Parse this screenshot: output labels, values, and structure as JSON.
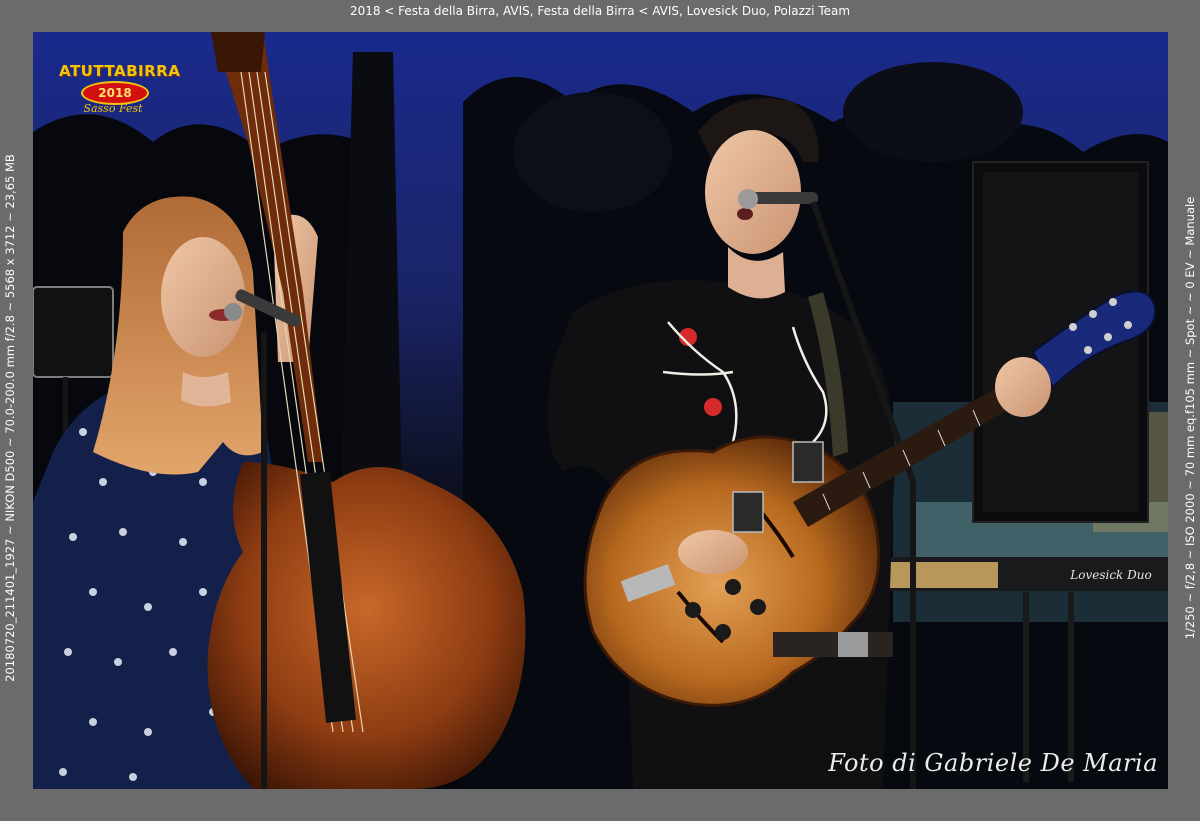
{
  "header": {
    "caption": "2018 < Festa della Birra, AVIS, Festa della Birra < AVIS, Lovesick Duo, Polazzi Team"
  },
  "sidebar_left": {
    "caption": "20180720_211401_1927 ~ NIKON D500 ~ 70.0-200.0 mm f/2.8 ~ 5568 x 3712 ~ 23,65 MB"
  },
  "sidebar_right": {
    "caption": "1/250 ~ f/2,8 ~ ISO 2000 ~ 70 mm eq.f105 mm ~ Spot ~ ~ 0 EV ~ Manuale"
  },
  "photo": {
    "logo": {
      "line1": "ATUTTABIRRA",
      "year": "2018",
      "line2": "Sasso Fest"
    },
    "watermark": "Foto di Gabriele De Maria",
    "keyboard_brand": "Lovesick Duo"
  },
  "colors": {
    "frame": "#6b6b6b",
    "sky": "#1c2f8a",
    "guitar": "#b8691f",
    "bass": "#a34a16",
    "logo_red": "#d40f0f",
    "logo_gold": "#f1c40f"
  }
}
